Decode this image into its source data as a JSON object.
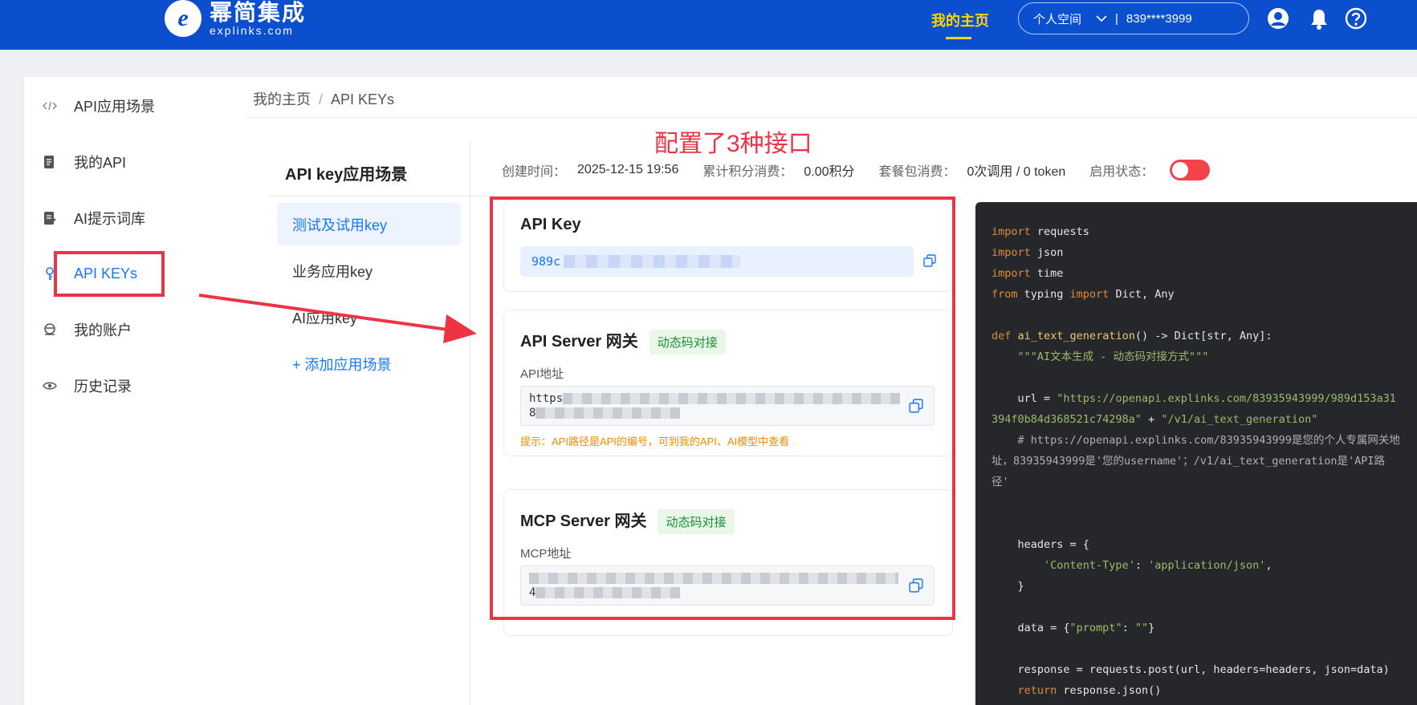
{
  "header": {
    "logo_letter": "e",
    "brand_name": "幂简集成",
    "brand_domain": "explinks.com",
    "nav_home": "我的主页",
    "space_label": "个人空间",
    "account_masked": "839****3999",
    "icons": [
      "user-icon",
      "bell-icon",
      "help-icon"
    ]
  },
  "sidebar": {
    "items": [
      {
        "label": "API应用场景",
        "icon": "code-icon"
      },
      {
        "label": "我的API",
        "icon": "document-icon"
      },
      {
        "label": "AI提示词库",
        "icon": "edit-list-icon"
      },
      {
        "label": "API KEYs",
        "icon": "key-icon",
        "active": true
      },
      {
        "label": "我的账户",
        "icon": "account-icon"
      },
      {
        "label": "历史记录",
        "icon": "eye-icon"
      }
    ]
  },
  "breadcrumb": {
    "home": "我的主页",
    "separator": "/",
    "current": "API KEYs"
  },
  "subnav": {
    "title": "API key应用场景",
    "items": [
      "测试及试用key",
      "业务应用key",
      "AI应用key"
    ],
    "add_label": "+ 添加应用场景"
  },
  "annotation": {
    "title": "配置了3种接口"
  },
  "meta": {
    "created_label": "创建时间：",
    "created_value": "2025-12-15 19:56",
    "points_label": "累计积分消费：",
    "points_value": "0.00积分",
    "package_label": "套餐包消费：",
    "package_value": "0次调用 / 0 token",
    "status_label": "启用状态："
  },
  "api_key_card": {
    "title": "API Key",
    "value_prefix": "989c"
  },
  "api_server_card": {
    "title": "API Server 网关",
    "badge": "动态码对接",
    "field_label": "API地址",
    "line1_prefix": "https",
    "line2_prefix": "8",
    "hint": "提示：API路径是API的编号，可到我的API、AI模型中查看"
  },
  "mcp_server_card": {
    "title": "MCP Server 网关",
    "badge": "动态码对接",
    "field_label": "MCP地址",
    "line2_prefix": "4"
  },
  "code": {
    "lines": [
      [
        {
          "t": "import",
          "c": "kw"
        },
        {
          "t": " requests",
          "c": ""
        }
      ],
      [
        {
          "t": "import",
          "c": "kw"
        },
        {
          "t": " json",
          "c": ""
        }
      ],
      [
        {
          "t": "import",
          "c": "kw"
        },
        {
          "t": " time",
          "c": ""
        }
      ],
      [
        {
          "t": "from",
          "c": "kw"
        },
        {
          "t": " typing ",
          "c": ""
        },
        {
          "t": "import",
          "c": "kw"
        },
        {
          "t": " Dict, Any",
          "c": ""
        }
      ],
      [],
      [
        {
          "t": "def",
          "c": "kw"
        },
        {
          "t": " ",
          "c": ""
        },
        {
          "t": "ai_text_generation",
          "c": "fn"
        },
        {
          "t": "() -> Dict[str, Any]:",
          "c": ""
        }
      ],
      [
        {
          "t": "    \"\"\"AI文本生成 - 动态码对接方式\"\"\"",
          "c": "str"
        }
      ],
      [],
      [
        {
          "t": "    url = ",
          "c": ""
        },
        {
          "t": "\"https://openapi.explinks.com/83935943999/989d153a31394f0b84d368521c74298a\"",
          "c": "str"
        },
        {
          "t": " + ",
          "c": ""
        },
        {
          "t": "\"/v1/ai_text_generation\"",
          "c": "str"
        }
      ],
      [
        {
          "t": "    # https://openapi.explinks.com/83935943999是您的个人专属网关地址，83935943999是'您的username'；/v1/ai_text_generation是'API路径'",
          "c": "cmt"
        }
      ],
      [],
      [],
      [
        {
          "t": "    headers = {",
          "c": ""
        }
      ],
      [
        {
          "t": "        ",
          "c": ""
        },
        {
          "t": "'Content-Type'",
          "c": "str"
        },
        {
          "t": ": ",
          "c": ""
        },
        {
          "t": "'application/json'",
          "c": "str"
        },
        {
          "t": ",",
          "c": ""
        }
      ],
      [
        {
          "t": "    }",
          "c": ""
        }
      ],
      [],
      [
        {
          "t": "    data = {",
          "c": ""
        },
        {
          "t": "\"prompt\"",
          "c": "str"
        },
        {
          "t": ": ",
          "c": ""
        },
        {
          "t": "\"\"",
          "c": "str"
        },
        {
          "t": "}",
          "c": ""
        }
      ],
      [],
      [
        {
          "t": "    response = requests.post(url, headers=headers, json=data)",
          "c": ""
        }
      ],
      [
        {
          "t": "    ",
          "c": ""
        },
        {
          "t": "return",
          "c": "kw"
        },
        {
          "t": " response.json()",
          "c": ""
        }
      ]
    ]
  },
  "colors": {
    "brand_blue": "#0b4fcf",
    "nav_active": "#ffd400",
    "accent": "#1677ff",
    "annotation_red": "#ee3344",
    "badge_green": "#1a8f3a",
    "hint_orange": "#f08c00",
    "toggle_off": "#f5434c",
    "code_bg": "#26272b"
  }
}
